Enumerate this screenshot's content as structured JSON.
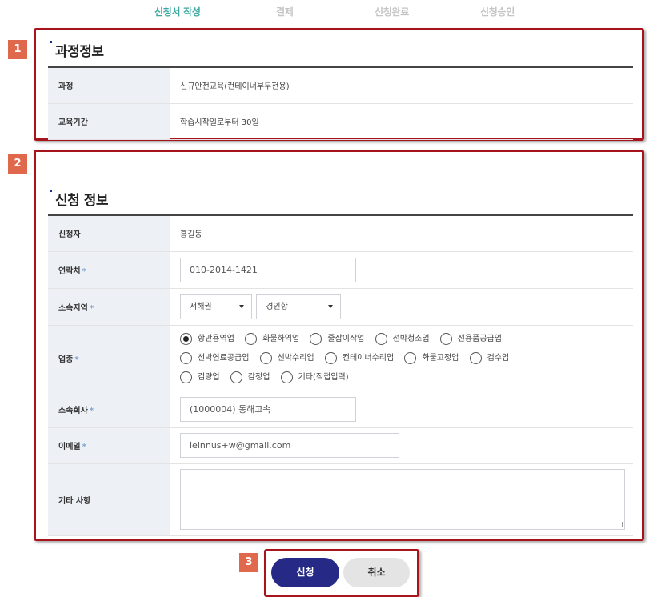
{
  "steps": [
    "신청서 작성",
    "결제",
    "신청완료",
    "신청승인"
  ],
  "badges": [
    "1",
    "2",
    "3"
  ],
  "course_section": {
    "title": "과정정보",
    "rows": [
      {
        "label": "과정",
        "value": "신규안전교육(컨테이너부두전용)"
      },
      {
        "label": "교육기간",
        "value": "학습시작일로부터 30일"
      }
    ]
  },
  "apply_section": {
    "title": "신청 정보",
    "applicant": {
      "label": "신청자",
      "value": "홍길동"
    },
    "contact": {
      "label": "연락처",
      "required_mark": "*",
      "value": "010-2014-1421"
    },
    "region": {
      "label": "소속지역",
      "required_mark": "*",
      "select1": "서해권",
      "select2": "경인항"
    },
    "industry": {
      "label": "업종",
      "required_mark": "*",
      "options": [
        "항만용역업",
        "화물하역업",
        "줄잡이작업",
        "선박청소업",
        "선용품공급업",
        "선박연료공급업",
        "선박수리업",
        "컨테이너수리업",
        "화물고정업",
        "검수업",
        "검량업",
        "감정업",
        "기타(직접입력)"
      ],
      "selected": "항만용역업"
    },
    "company": {
      "label": "소속회사",
      "required_mark": "*",
      "value": "(1000004) 동해고속"
    },
    "email": {
      "label": "이메일",
      "required_mark": "*",
      "value": "leinnus+w@gmail.com"
    },
    "etc": {
      "label": "기타 사항",
      "value": ""
    }
  },
  "buttons": {
    "apply": "신청",
    "cancel": "취소"
  },
  "colors": {
    "active_step": "#3aa8a0",
    "primary_button": "#262a86",
    "annotation_border": "#a8141c",
    "badge": "#e0684c"
  }
}
